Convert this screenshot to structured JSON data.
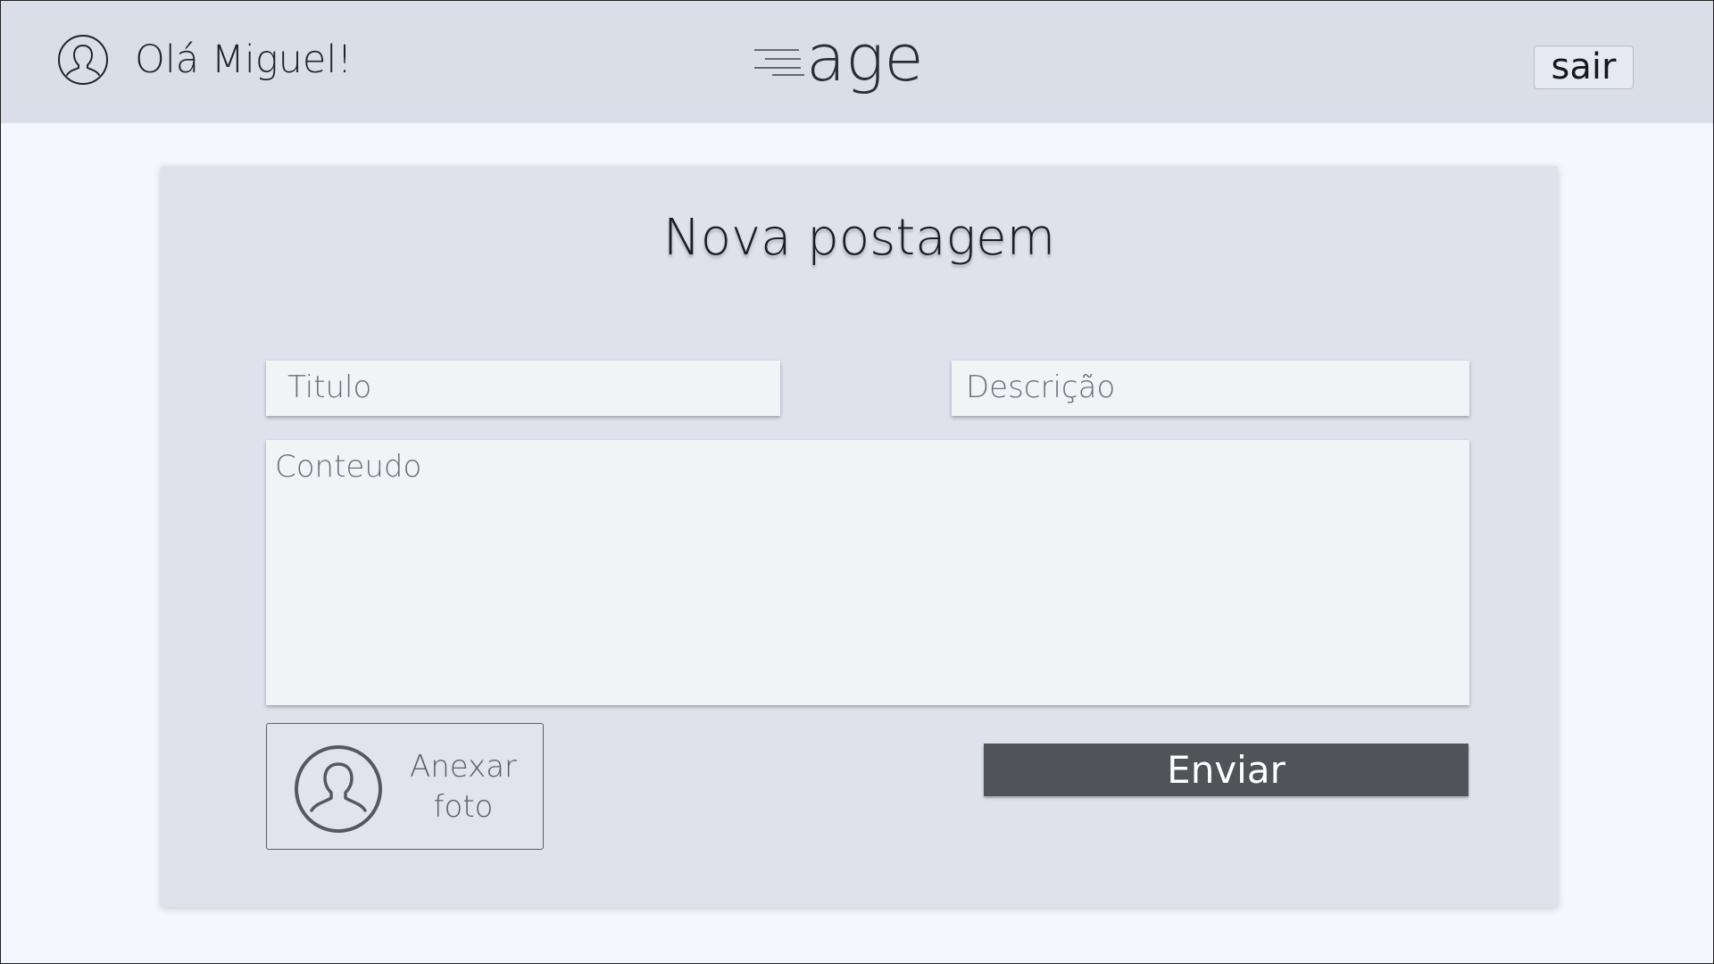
{
  "header": {
    "greeting": "Olá Miguel!",
    "logo_text": "age",
    "logout_label": "sair"
  },
  "card": {
    "title": "Nova postagem",
    "title_placeholder": "Titulo",
    "description_placeholder": "Descrição",
    "content_placeholder": "Conteudo",
    "attach_label_line1": "Anexar",
    "attach_label_line2": "foto",
    "submit_label": "Enviar"
  },
  "icons": {
    "user": "user-icon",
    "attach": "user-avatar-icon"
  },
  "colors": {
    "header_bg": "#dadee8",
    "page_bg": "#f4f7fd",
    "card_bg": "#dfe2ed",
    "submit_bg": "#525358"
  }
}
